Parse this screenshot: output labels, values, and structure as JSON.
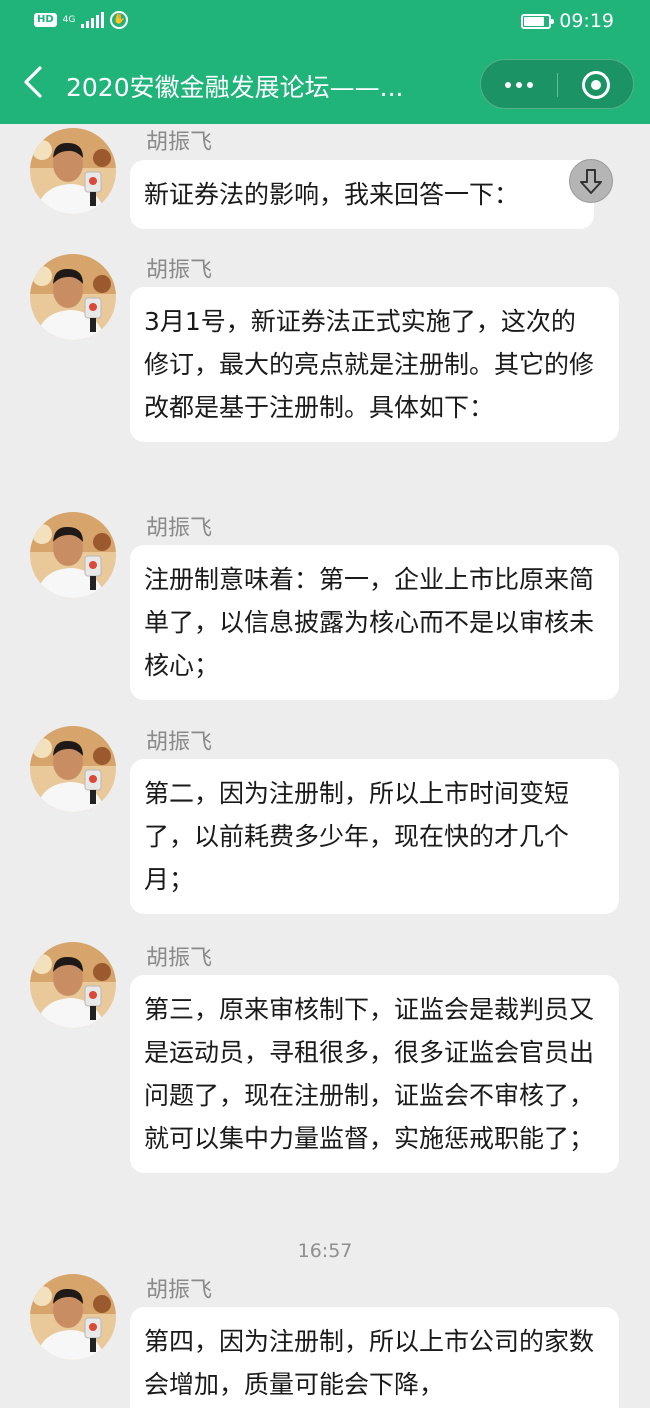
{
  "status_bar": {
    "hd_label": "HD",
    "network_label": "4G",
    "time": "09:19",
    "battery_level": 0.9,
    "icons": [
      "hd-icon",
      "signal-icon",
      "gesture-icon",
      "battery-icon"
    ]
  },
  "header": {
    "title": "2020安徽金融发展论坛——...",
    "icons": [
      "back-icon",
      "more-icon",
      "close-miniprogram-icon"
    ],
    "colors": {
      "bar": "#21b47a",
      "chat_bg": "#ededed",
      "bubble": "#ffffff",
      "sender": "#8a8a8a"
    }
  },
  "chat": {
    "messages": [
      {
        "sender": "胡振飞",
        "text": "新证券法的影响，我来回答一下："
      },
      {
        "sender": "胡振飞",
        "text": "3月1号，新证券法正式实施了，这次的修订，最大的亮点就是注册制。其它的修改都是基于注册制。具体如下："
      },
      {
        "sender": "胡振飞",
        "text": "注册制意味着：第一，企业上市比原来简单了，以信息披露为核心而不是以审核未核心；"
      },
      {
        "sender": "胡振飞",
        "text": "第二，因为注册制，所以上市时间变短了，以前耗费多少年，现在快的才几个月；"
      },
      {
        "sender": "胡振飞",
        "text": "第三，原来审核制下，证监会是裁判员又是运动员，寻租很多，很多证监会官员出问题了，现在注册制，证监会不审核了，就可以集中力量监督，实施惩戒职能了；"
      },
      {
        "sender": "胡振飞",
        "text": "第四，因为注册制，所以上市公司的家数会增加，质量可能会下降，"
      }
    ],
    "timestamp": "16:57",
    "scroll_icon": "arrow-down-icon"
  }
}
